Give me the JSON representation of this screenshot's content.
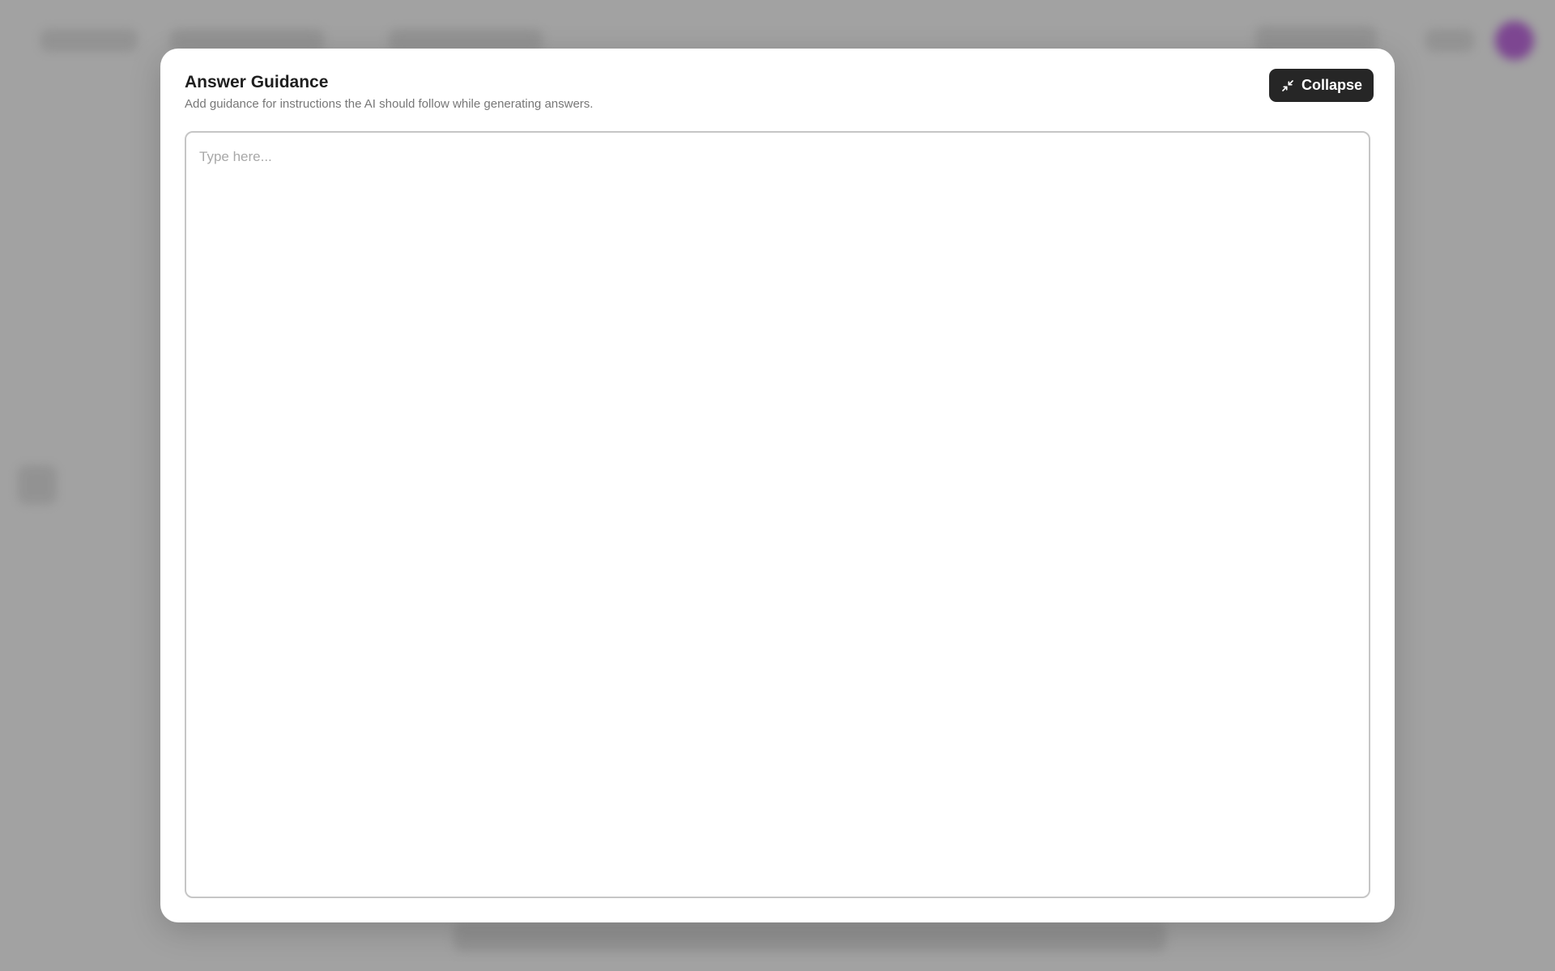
{
  "background": {
    "avatar_color": "#b868d6"
  },
  "modal": {
    "title": "Answer Guidance",
    "subtitle": "Add guidance for instructions the AI should follow while generating answers.",
    "collapse_button": {
      "label": "Collapse",
      "icon": "collapse-arrows-icon"
    },
    "editor": {
      "value": "",
      "placeholder": "Type here..."
    }
  }
}
